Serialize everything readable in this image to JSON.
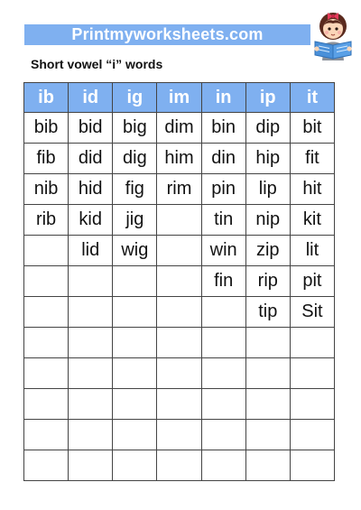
{
  "header": {
    "banner_text": "Printmyworksheets.com",
    "mascot_icon": "girl-reading-book-icon"
  },
  "title": "Short vowel “i” words",
  "table": {
    "columns": [
      "ib",
      "id",
      "ig",
      "im",
      "in",
      "ip",
      "it"
    ],
    "rows": [
      [
        "bib",
        "bid",
        "big",
        "dim",
        "bin",
        "dip",
        "bit"
      ],
      [
        "fib",
        "did",
        "dig",
        "him",
        "din",
        "hip",
        "fit"
      ],
      [
        "nib",
        "hid",
        "fig",
        "rim",
        "pin",
        "lip",
        "hit"
      ],
      [
        "rib",
        "kid",
        "jig",
        "",
        "tin",
        "nip",
        "kit"
      ],
      [
        "",
        "lid",
        "wig",
        "",
        "win",
        "zip",
        "lit"
      ],
      [
        "",
        "",
        "",
        "",
        "fin",
        "rip",
        "pit"
      ],
      [
        "",
        "",
        "",
        "",
        "",
        "tip",
        "Sit"
      ],
      [
        "",
        "",
        "",
        "",
        "",
        "",
        ""
      ],
      [
        "",
        "",
        "",
        "",
        "",
        "",
        ""
      ],
      [
        "",
        "",
        "",
        "",
        "",
        "",
        ""
      ],
      [
        "",
        "",
        "",
        "",
        "",
        "",
        ""
      ],
      [
        "",
        "",
        "",
        "",
        "",
        "",
        ""
      ]
    ]
  },
  "colors": {
    "header_blue": "#7fb0f0",
    "grid_line": "#444444",
    "text": "#111111"
  }
}
